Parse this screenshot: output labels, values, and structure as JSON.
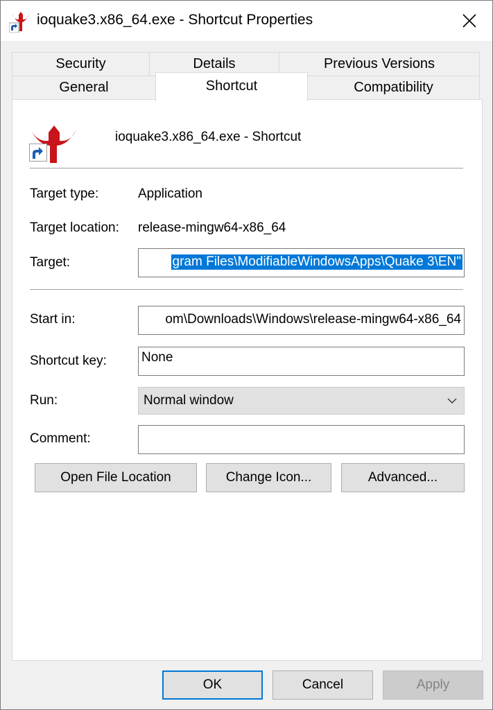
{
  "window": {
    "title": "ioquake3.x86_64.exe - Shortcut Properties",
    "close_icon": "close-icon"
  },
  "tabs": {
    "row1": [
      {
        "label": "Security"
      },
      {
        "label": "Details"
      },
      {
        "label": "Previous Versions"
      }
    ],
    "row2": [
      {
        "label": "General"
      },
      {
        "label": "Shortcut",
        "active": true
      },
      {
        "label": "Compatibility"
      }
    ]
  },
  "shortcut": {
    "name": "ioquake3.x86_64.exe - Shortcut",
    "icon": "quake3-logo-icon",
    "target_type_label": "Target type:",
    "target_type_value": "Application",
    "target_location_label": "Target location:",
    "target_location_value": "release-mingw64-x86_64",
    "target_label": "Target:",
    "target_value": "gram Files\\ModifiableWindowsApps\\Quake 3\\EN\"",
    "start_in_label": "Start in:",
    "start_in_value": "om\\Downloads\\Windows\\release-mingw64-x86_64",
    "shortcut_key_label": "Shortcut key:",
    "shortcut_key_value": "None",
    "run_label": "Run:",
    "run_value": "Normal window",
    "comment_label": "Comment:",
    "comment_value": "",
    "open_file_location": "Open File Location",
    "change_icon": "Change Icon...",
    "advanced": "Advanced..."
  },
  "footer": {
    "ok": "OK",
    "cancel": "Cancel",
    "apply": "Apply"
  },
  "colors": {
    "accent": "#0078d7",
    "icon_red": "#c8141a"
  }
}
